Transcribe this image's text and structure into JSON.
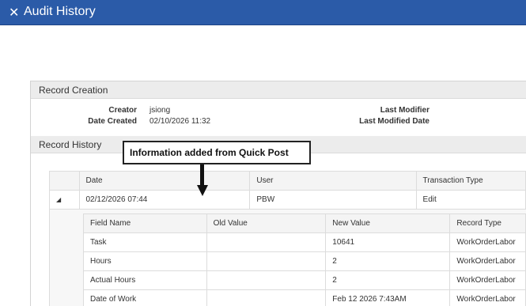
{
  "window": {
    "title": "Audit History",
    "close_icon": "✕"
  },
  "record_creation": {
    "title": "Record Creation",
    "creator_label": "Creator",
    "creator_value": "jsiong",
    "date_created_label": "Date Created",
    "date_created_value": "02/10/2026 11:32",
    "last_modifier_label": "Last Modifier",
    "last_modified_date_label": "Last Modified Date"
  },
  "record_history": {
    "title": "Record History",
    "callout": "Information added from Quick Post",
    "columns": [
      "Date",
      "User",
      "Transaction Type"
    ],
    "rows": [
      {
        "expander": "◢",
        "date": "02/12/2026 07:44",
        "user": "PBW",
        "transaction_type": "Edit"
      }
    ],
    "detail_columns": [
      "Field Name",
      "Old Value",
      "New Value",
      "Record Type"
    ],
    "detail_rows": [
      {
        "field": "Task",
        "old": "",
        "new": "10641",
        "type": "WorkOrderLabor"
      },
      {
        "field": "Hours",
        "old": "",
        "new": "2",
        "type": "WorkOrderLabor"
      },
      {
        "field": "Actual Hours",
        "old": "",
        "new": "2",
        "type": "WorkOrderLabor"
      },
      {
        "field": "Date of Work",
        "old": "",
        "new": "Feb 12 2026 7:43AM",
        "type": "WorkOrderLabor"
      }
    ]
  }
}
